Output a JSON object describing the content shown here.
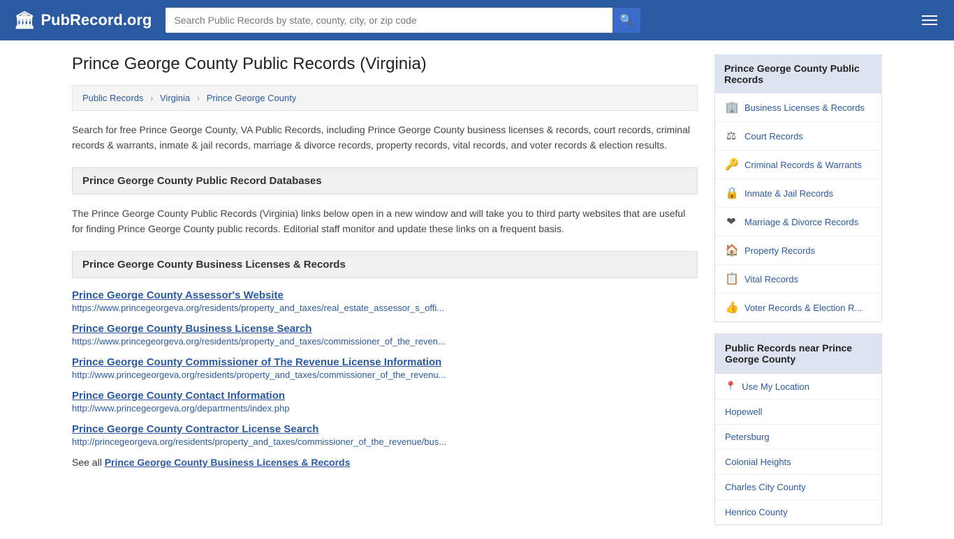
{
  "header": {
    "logo_icon": "🏛",
    "logo_text": "PubRecord.org",
    "search_placeholder": "Search Public Records by state, county, city, or zip code",
    "search_button_icon": "🔍"
  },
  "breadcrumb": {
    "items": [
      {
        "label": "Public Records",
        "href": "#"
      },
      {
        "label": "Virginia",
        "href": "#"
      },
      {
        "label": "Prince George County",
        "href": "#"
      }
    ]
  },
  "page": {
    "title": "Prince George County Public Records (Virginia)",
    "description": "Search for free Prince George County, VA Public Records, including Prince George County business licenses & records, court records, criminal records & warrants, inmate & jail records, marriage & divorce records, property records, vital records, and voter records & election results.",
    "databases_header": "Prince George County Public Record Databases",
    "databases_description": "The Prince George County Public Records (Virginia) links below open in a new window and will take you to third party websites that are useful for finding Prince George County public records. Editorial staff monitor and update these links on a frequent basis.",
    "business_header": "Prince George County Business Licenses & Records"
  },
  "links": [
    {
      "title": "Prince George County Assessor's Website",
      "url": "https://www.princegeorgeva.org/residents/property_and_taxes/real_estate_assessor_s_offi..."
    },
    {
      "title": "Prince George County Business License Search",
      "url": "https://www.princegeorgeva.org/residents/property_and_taxes/commissioner_of_the_reven..."
    },
    {
      "title": "Prince George County Commissioner of The Revenue License Information",
      "url": "http://www.princegeorgeva.org/residents/property_and_taxes/commissioner_of_the_revenu..."
    },
    {
      "title": "Prince George County Contact Information",
      "url": "http://www.princegeorgeva.org/departments/index.php"
    },
    {
      "title": "Prince George County Contractor License Search",
      "url": "http://princegeorgeva.org/residents/property_and_taxes/commissioner_of_the_revenue/bus..."
    }
  ],
  "see_all_text": "See all ",
  "see_all_link": "Prince George County Business Licenses & Records",
  "sidebar": {
    "section_title": "Prince George County Public Records",
    "nav_items": [
      {
        "icon": "🏢",
        "label": "Business Licenses & Records"
      },
      {
        "icon": "⚖",
        "label": "Court Records"
      },
      {
        "icon": "🔑",
        "label": "Criminal Records & Warrants"
      },
      {
        "icon": "🔒",
        "label": "Inmate & Jail Records"
      },
      {
        "icon": "💞",
        "label": "Marriage & Divorce Records"
      },
      {
        "icon": "🏠",
        "label": "Property Records"
      },
      {
        "icon": "📋",
        "label": "Vital Records"
      },
      {
        "icon": "👆",
        "label": "Voter Records & Election R..."
      }
    ],
    "nearby_title": "Public Records near Prince George County",
    "use_location_label": "Use My Location",
    "nearby_locations": [
      "Hopewell",
      "Petersburg",
      "Colonial Heights",
      "Charles City County",
      "Henrico County"
    ]
  }
}
